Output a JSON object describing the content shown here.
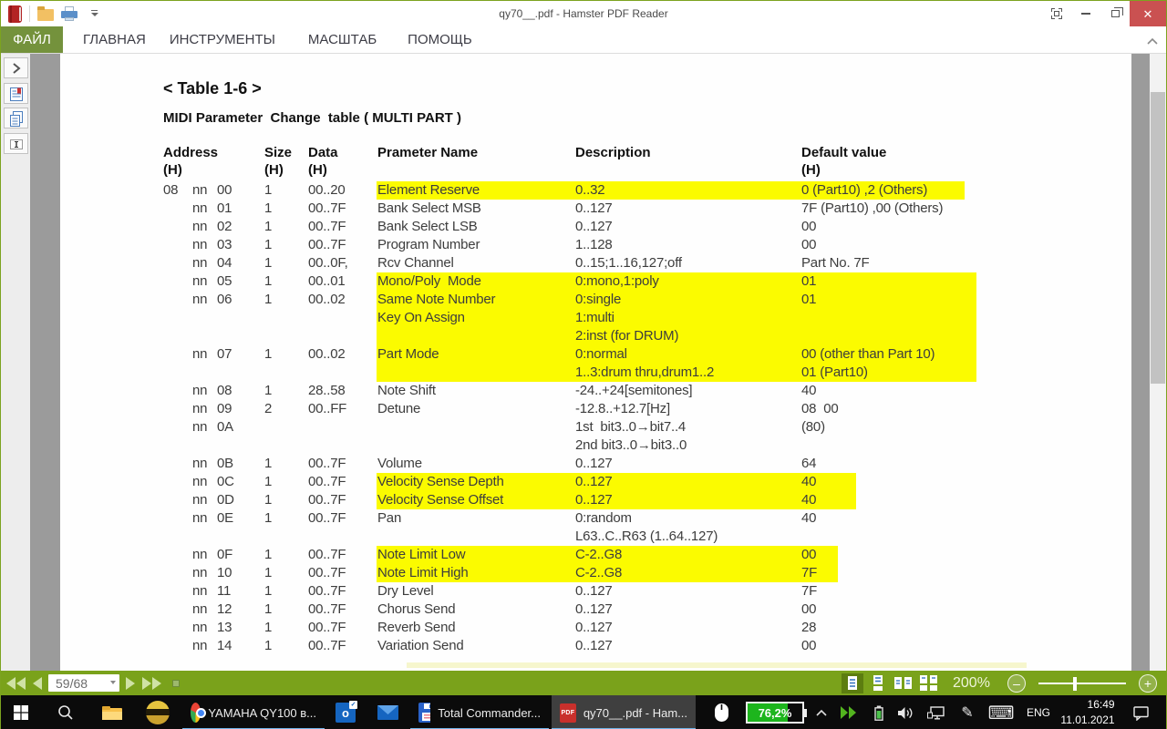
{
  "window": {
    "title": "qy70__.pdf - Hamster PDF Reader",
    "menu_tabs": [
      {
        "label": "ФАЙЛ",
        "active": true
      },
      {
        "label": "ГЛАВНАЯ",
        "active": false
      },
      {
        "label": "ИНСТРУМЕНТЫ",
        "active": false
      },
      {
        "label": "МАСШТАБ",
        "active": false
      },
      {
        "label": "ПОМОЩЬ",
        "active": false
      }
    ],
    "colors": {
      "file_tab_green": "#74923c",
      "statusbar_green": "#7aa21b",
      "close_red": "#ca5151",
      "highlight_yellow": "#fbfb00",
      "task_underline_blue": "#70b5e9"
    }
  },
  "document": {
    "table_title": "< Table 1-6 >",
    "subtitle": "MIDI Parameter  Change  table ( MULTI PART )",
    "columns": [
      {
        "label": "Address",
        "sub": "(H)"
      },
      {
        "label": "Size",
        "sub": "(H)"
      },
      {
        "label": "Data",
        "sub": "(H)"
      },
      {
        "label": "Prameter Name",
        "sub": ""
      },
      {
        "label": "Description",
        "sub": ""
      },
      {
        "label": "Default value",
        "sub": "(H)"
      }
    ],
    "highlight_widths": {
      "r1": 645,
      "b": 658,
      "c": 526,
      "d": 506
    },
    "rows": [
      {
        "a1": "08",
        "a2": "nn",
        "a3": "00",
        "size": "1",
        "data": "00..20",
        "name": "Element Reserve",
        "desc": "0..32",
        "def": "0 (Part10) ,2 (Others)",
        "hl": "r1"
      },
      {
        "a2": "nn",
        "a3": "01",
        "size": "1",
        "data": "00..7F",
        "name": "Bank Select MSB",
        "desc": "0..127",
        "def": "7F (Part10) ,00 (Others)"
      },
      {
        "a2": "nn",
        "a3": "02",
        "size": "1",
        "data": "00..7F",
        "name": "Bank Select LSB",
        "desc": "0..127",
        "def": "00"
      },
      {
        "a2": "nn",
        "a3": "03",
        "size": "1",
        "data": "00..7F",
        "name": "Program Number",
        "desc": "1..128",
        "def": "00"
      },
      {
        "a2": "nn",
        "a3": "04",
        "size": "1",
        "data": "00..0F,",
        "name": "Rcv Channel",
        "desc": "0..15;1..16,127;off",
        "def": "Part No. 7F"
      },
      {
        "a2": "nn",
        "a3": "05",
        "size": "1",
        "data": "00..01",
        "name": "Mono/Poly  Mode",
        "desc": "0:mono,1:poly",
        "def": "01",
        "hl": "b"
      },
      {
        "a2": "nn",
        "a3": "06",
        "size": "1",
        "data": "00..02",
        "name": "Same Note Number",
        "desc": "0:single",
        "def": "01",
        "hl": "b"
      },
      {
        "name": "Key On Assign",
        "desc": "1:multi",
        "hl": "b"
      },
      {
        "desc": "2:inst (for DRUM)",
        "hl": "b"
      },
      {
        "a2": "nn",
        "a3": "07",
        "size": "1",
        "data": "00..02",
        "name": "Part Mode",
        "desc": "0:normal",
        "def": "00 (other than Part 10)",
        "hl": "b"
      },
      {
        "desc": "1..3:drum thru,drum1..2",
        "def": "01 (Part10)",
        "hl": "b"
      },
      {
        "a2": "nn",
        "a3": "08",
        "size": "1",
        "data": "28..58",
        "name": "Note Shift",
        "desc": "-24..+24[semitones]",
        "def": "40"
      },
      {
        "a2": "nn",
        "a3": "09",
        "size": "2",
        "data": "00..FF",
        "name": "Detune",
        "desc": "-12.8..+12.7[Hz]",
        "def": "08  00"
      },
      {
        "a2": "nn",
        "a3": "0A",
        "desc": "1st  bit3..0→bit7..4",
        "def": "(80)"
      },
      {
        "desc": "2nd bit3..0→bit3..0"
      },
      {
        "a2": "nn",
        "a3": "0B",
        "size": "1",
        "data": "00..7F",
        "name": "Volume",
        "desc": "0..127",
        "def": "64"
      },
      {
        "a2": "nn",
        "a3": "0C",
        "size": "1",
        "data": "00..7F",
        "name": "Velocity Sense Depth",
        "desc": "0..127",
        "def": "40",
        "hl": "c"
      },
      {
        "a2": "nn",
        "a3": "0D",
        "size": "1",
        "data": "00..7F",
        "name": "Velocity Sense Offset",
        "desc": "0..127",
        "def": "40",
        "hl": "c"
      },
      {
        "a2": "nn",
        "a3": "0E",
        "size": "1",
        "data": "00..7F",
        "name": "Pan",
        "desc": "0:random",
        "def": "40"
      },
      {
        "desc": "L63..C..R63 (1..64..127)"
      },
      {
        "a2": "nn",
        "a3": "0F",
        "size": "1",
        "data": "00..7F",
        "name": "Note Limit Low",
        "desc": "C-2..G8",
        "def": "00",
        "hl": "d"
      },
      {
        "a2": "nn",
        "a3": "10",
        "size": "1",
        "data": "00..7F",
        "name": "Note Limit High",
        "desc": "C-2..G8",
        "def": "7F",
        "hl": "d"
      },
      {
        "a2": "nn",
        "a3": "11",
        "size": "1",
        "data": "00..7F",
        "name": "Dry Level",
        "desc": "0..127",
        "def": "7F"
      },
      {
        "a2": "nn",
        "a3": "12",
        "size": "1",
        "data": "00..7F",
        "name": "Chorus Send",
        "desc": "0..127",
        "def": "00"
      },
      {
        "a2": "nn",
        "a3": "13",
        "size": "1",
        "data": "00..7F",
        "name": "Reverb Send",
        "desc": "0..127",
        "def": "28"
      },
      {
        "a2": "nn",
        "a3": "14",
        "size": "1",
        "data": "00..7F",
        "name": "Variation Send",
        "desc": "0..127",
        "def": "00"
      }
    ]
  },
  "statusbar": {
    "page_indicator": "59/68",
    "zoom_level": "200%",
    "minus_label": "–",
    "plus_label": "+"
  },
  "taskbar": {
    "tasks": {
      "chrome_label": "YAMAHA QY100 в...",
      "total_commander_label": "Total Commander...",
      "pdf_label": "qy70__.pdf - Ham..."
    },
    "outlook_letter": "o",
    "outlook_check": "✓",
    "pdf_icon_text": "PDF",
    "battery_widget": "76,2%",
    "language": "ENG",
    "time": "16:49",
    "date": "11.01.2021",
    "pen_glyph": "✎",
    "keyboard_glyph": "⌨"
  }
}
